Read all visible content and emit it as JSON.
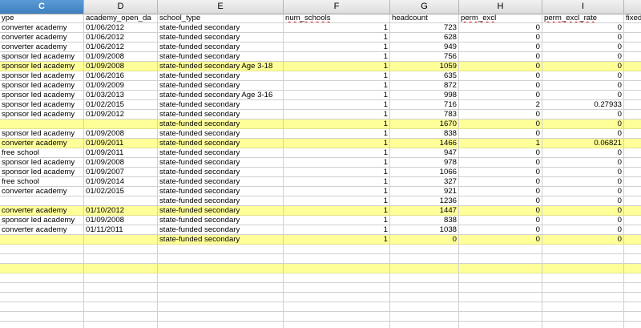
{
  "columns": [
    {
      "letter": "C",
      "selected": true
    },
    {
      "letter": "D",
      "selected": false
    },
    {
      "letter": "E",
      "selected": false
    },
    {
      "letter": "F",
      "selected": false
    },
    {
      "letter": "G",
      "selected": false
    },
    {
      "letter": "H",
      "selected": false
    },
    {
      "letter": "I",
      "selected": false
    },
    {
      "letter": "",
      "selected": false
    }
  ],
  "header_row": [
    "ype",
    "academy_open_da",
    "school_type",
    "num_schools",
    "headcount",
    "perm_excl",
    "perm_excl_rate",
    "fixed"
  ],
  "rows": [
    {
      "hl": false,
      "c": [
        "converter academy",
        "01/06/2012",
        "state-funded secondary",
        "1",
        "723",
        "0",
        "0"
      ]
    },
    {
      "hl": false,
      "c": [
        "converter academy",
        "01/06/2012",
        "state-funded secondary",
        "1",
        "628",
        "0",
        "0"
      ]
    },
    {
      "hl": false,
      "c": [
        "converter academy",
        "01/06/2012",
        "state-funded secondary",
        "1",
        "949",
        "0",
        "0"
      ]
    },
    {
      "hl": false,
      "c": [
        "sponsor led academy",
        "01/09/2008",
        "state-funded secondary",
        "1",
        "756",
        "0",
        "0"
      ]
    },
    {
      "hl": true,
      "c": [
        "sponsor led academy",
        "01/09/2008",
        "state-funded secondary Age 3-18",
        "1",
        "1059",
        "0",
        "0"
      ]
    },
    {
      "hl": false,
      "c": [
        "sponsor led academy",
        "01/06/2016",
        "state-funded secondary",
        "1",
        "635",
        "0",
        "0"
      ]
    },
    {
      "hl": false,
      "c": [
        "sponsor led academy",
        "01/09/2009",
        "state-funded secondary",
        "1",
        "872",
        "0",
        "0"
      ]
    },
    {
      "hl": false,
      "c": [
        "sponsor led academy",
        "01/03/2013",
        "state-funded secondary Age 3-16",
        "1",
        "998",
        "0",
        "0"
      ]
    },
    {
      "hl": false,
      "c": [
        "sponsor led academy",
        "01/02/2015",
        "state-funded secondary",
        "1",
        "716",
        "2",
        "0.27933"
      ]
    },
    {
      "hl": false,
      "c": [
        "sponsor led academy",
        "01/09/2012",
        "state-funded secondary",
        "1",
        "783",
        "0",
        "0"
      ]
    },
    {
      "hl": true,
      "c": [
        "",
        "",
        "state-funded secondary",
        "1",
        "1670",
        "0",
        "0"
      ]
    },
    {
      "hl": false,
      "c": [
        "sponsor led academy",
        "01/09/2008",
        "state-funded secondary",
        "1",
        "838",
        "0",
        "0"
      ]
    },
    {
      "hl": true,
      "c": [
        "converter academy",
        "01/09/2011",
        "state-funded secondary",
        "1",
        "1466",
        "1",
        "0.06821"
      ]
    },
    {
      "hl": false,
      "c": [
        "free school",
        "01/09/2011",
        "state-funded secondary",
        "1",
        "947",
        "0",
        "0"
      ]
    },
    {
      "hl": false,
      "c": [
        "sponsor led academy",
        "01/09/2008",
        "state-funded secondary",
        "1",
        "978",
        "0",
        "0"
      ]
    },
    {
      "hl": false,
      "c": [
        "sponsor led academy",
        "01/09/2007",
        "state-funded secondary",
        "1",
        "1066",
        "0",
        "0"
      ]
    },
    {
      "hl": false,
      "c": [
        "free school",
        "01/09/2014",
        "state-funded secondary",
        "1",
        "327",
        "0",
        "0"
      ]
    },
    {
      "hl": false,
      "c": [
        "converter academy",
        "01/02/2015",
        "state-funded secondary",
        "1",
        "921",
        "0",
        "0"
      ]
    },
    {
      "hl": false,
      "c": [
        "",
        "",
        "state-funded secondary",
        "1",
        "1236",
        "0",
        "0"
      ]
    },
    {
      "hl": true,
      "c": [
        "converter academy",
        "01/10/2012",
        "state-funded secondary",
        "1",
        "1447",
        "0",
        "0"
      ]
    },
    {
      "hl": false,
      "c": [
        "sponsor led academy",
        "01/09/2008",
        "state-funded secondary",
        "1",
        "838",
        "0",
        "0"
      ]
    },
    {
      "hl": false,
      "c": [
        "converter academy",
        "01/11/2011",
        "state-funded secondary",
        "1",
        "1038",
        "0",
        "0"
      ]
    },
    {
      "hl": true,
      "c": [
        "",
        "",
        "state-funded secondary",
        "1",
        "0",
        "0",
        "0"
      ]
    },
    {
      "hl": false,
      "c": [
        "",
        "",
        "",
        "",
        "",
        "",
        ""
      ]
    },
    {
      "hl": false,
      "c": [
        "",
        "",
        "",
        "",
        "",
        "",
        ""
      ]
    },
    {
      "hl": true,
      "c": [
        "",
        "",
        "",
        "",
        "",
        "",
        ""
      ]
    },
    {
      "hl": false,
      "c": [
        "",
        "",
        "",
        "",
        "",
        "",
        ""
      ]
    },
    {
      "hl": false,
      "c": [
        "",
        "",
        "",
        "",
        "",
        "",
        ""
      ]
    },
    {
      "hl": false,
      "c": [
        "",
        "",
        "",
        "",
        "",
        "",
        ""
      ]
    },
    {
      "hl": false,
      "c": [
        "",
        "",
        "",
        "",
        "",
        "",
        ""
      ]
    },
    {
      "hl": false,
      "c": [
        "",
        "",
        "",
        "",
        "",
        "",
        ""
      ]
    },
    {
      "hl": false,
      "c": [
        "",
        "",
        "",
        "",
        "",
        "",
        ""
      ]
    }
  ]
}
